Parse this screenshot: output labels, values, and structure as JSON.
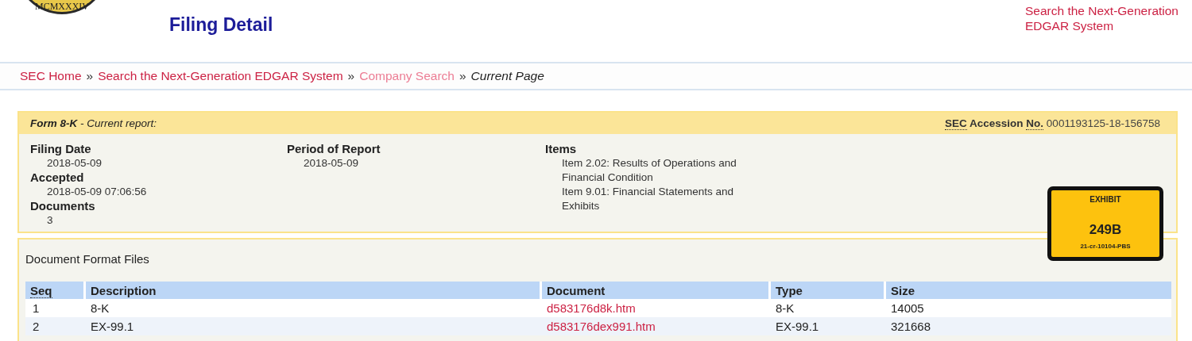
{
  "header": {
    "seal_text": "MCMXXXIV",
    "title": "Filing Detail",
    "top_link": "Search the Next-Generation EDGAR System"
  },
  "breadcrumb": [
    {
      "label": "SEC Home",
      "kind": "link",
      "visited": false
    },
    {
      "label": "Search the Next-Generation EDGAR System",
      "kind": "link",
      "visited": false
    },
    {
      "label": "Company Search",
      "kind": "link",
      "visited": true
    },
    {
      "label": "Current Page",
      "kind": "current"
    }
  ],
  "separator": "»",
  "filing": {
    "form": "Form 8-K",
    "form_desc": " - Current report:",
    "accession_label_1": "SEC",
    "accession_label_2": "Accession",
    "accession_label_3": "No.",
    "accession_number": "0001193125-18-156758",
    "groups": [
      {
        "fields": [
          {
            "label": "Filing Date",
            "value": "2018-05-09"
          },
          {
            "label": "Accepted",
            "value": "2018-05-09 07:06:56"
          },
          {
            "label": "Documents",
            "value": "3"
          }
        ]
      },
      {
        "fields": [
          {
            "label": "Period of Report",
            "value": "2018-05-09"
          }
        ]
      },
      {
        "fields": [
          {
            "label": "Items",
            "values": [
              "Item 2.02: Results of Operations and Financial Condition",
              "Item 9.01: Financial Statements and Exhibits"
            ]
          }
        ]
      }
    ]
  },
  "documents": {
    "title": "Document Format Files",
    "columns": [
      "Seq",
      "Description",
      "Document",
      "Type",
      "Size"
    ],
    "rows": [
      {
        "seq": "1",
        "description": "8-K",
        "document": "d583176d8k.htm",
        "type": "8-K",
        "size": "14005"
      },
      {
        "seq": "2",
        "description": "EX-99.1",
        "document": "d583176dex991.htm",
        "type": "EX-99.1",
        "size": "321668"
      }
    ]
  },
  "exhibit_sticker": {
    "label": "EXHIBIT",
    "number": "249B",
    "case": "21-cr-10104-PBS"
  }
}
